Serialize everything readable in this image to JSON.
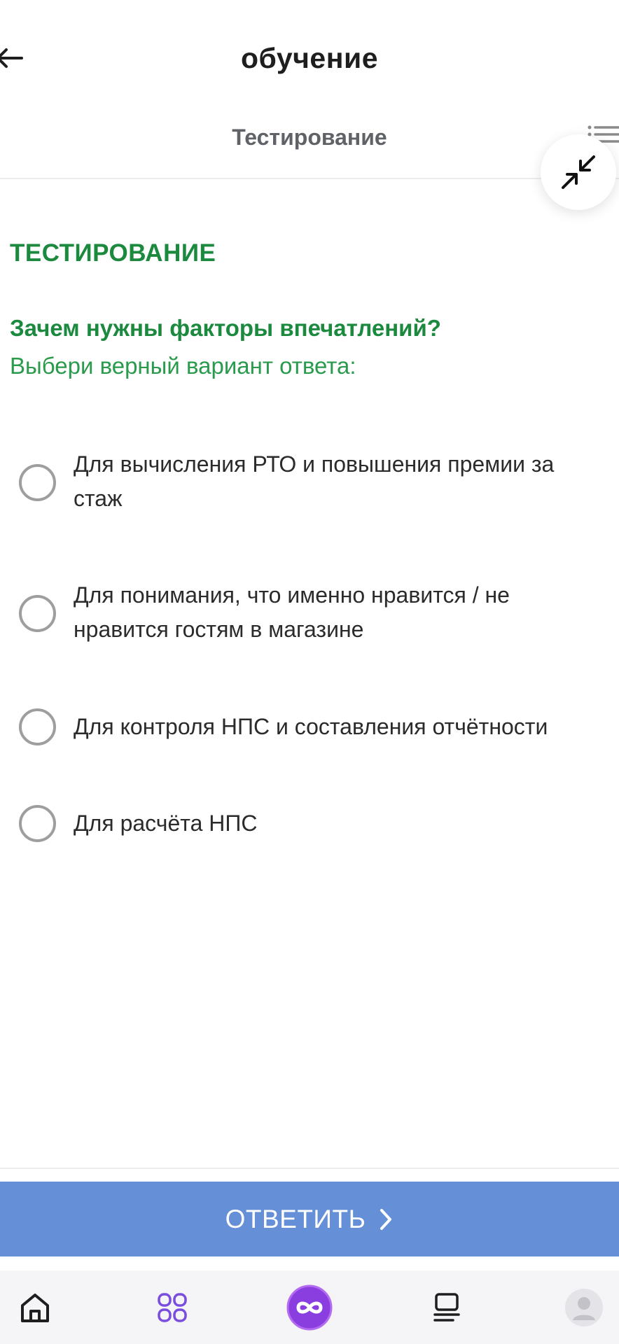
{
  "header": {
    "title": "обучение",
    "back_icon": "arrow-left-icon"
  },
  "section": {
    "title": "Тестирование",
    "menu_icon": "list-icon",
    "collapse_icon": "collapse-arrows-icon"
  },
  "test": {
    "label": "ТЕСТИРОВАНИЕ",
    "question": "Зачем нужны факторы впечатлений?",
    "instruction": "Выбери верный вариант ответа:",
    "options": [
      {
        "text": "Для вычисления РТО и повышения премии за стаж",
        "selected": false
      },
      {
        "text": "Для понимания, что именно нравится / не нравится гостям в магазине",
        "selected": false
      },
      {
        "text": "Для контроля НПС и составления отчётности",
        "selected": false
      },
      {
        "text": "Для расчёта НПС",
        "selected": false
      }
    ]
  },
  "answer_button": {
    "label": "ОТВЕТИТЬ",
    "icon": "chevron-right-icon"
  },
  "bottom_nav": {
    "items": [
      {
        "icon": "home-icon"
      },
      {
        "icon": "apps-grid-icon"
      },
      {
        "icon": "infinity-icon"
      },
      {
        "icon": "stack-icon"
      },
      {
        "icon": "avatar-icon"
      }
    ]
  },
  "colors": {
    "accent_green": "#1b8a3e",
    "button_blue": "#6590d8",
    "nav_purple": "#7a4de0"
  }
}
